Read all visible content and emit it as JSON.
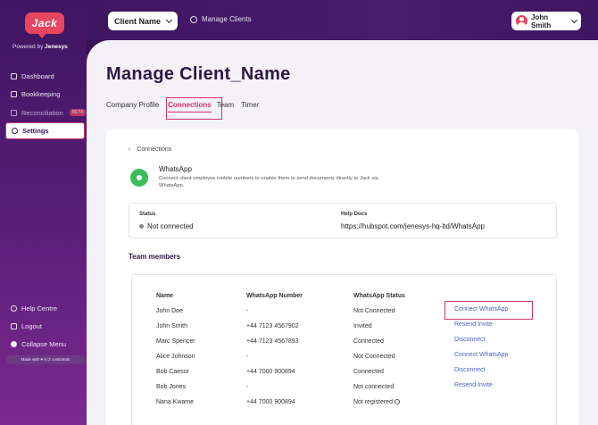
{
  "header": {
    "client_select": "Client Name",
    "manage_clients": "Manage Clients",
    "user_name": "John Smith"
  },
  "brand": {
    "logo_text": "Jack",
    "powered_by": "Powered by",
    "powered_brand": "Jenesys"
  },
  "sidebar": {
    "items": [
      {
        "label": "Dashboard",
        "icon": "grid-icon"
      },
      {
        "label": "Bookkeeping",
        "icon": "book-icon"
      },
      {
        "label": "Reconciliation",
        "icon": "reconcile-icon",
        "badge": "BETA"
      },
      {
        "label": "Settings",
        "icon": "gear-icon"
      }
    ],
    "bottom": [
      {
        "label": "Help Centre",
        "icon": "help-icon"
      },
      {
        "label": "Logout",
        "icon": "logout-icon"
      },
      {
        "label": "Collapse Menu",
        "icon": "collapse-icon"
      }
    ],
    "made_with": "Made with ♥ in 3 continents"
  },
  "page": {
    "title": "Manage Client_Name",
    "tabs": [
      "Company Profile",
      "Connections",
      "Team",
      "Timer"
    ],
    "active_tab": "Connections"
  },
  "connection": {
    "breadcrumb": "Connections",
    "name": "WhatsApp",
    "description": "Connect client employee mobile numbers to enable them to send documents directly to Jack via WhatsApp.",
    "status_label": "Status",
    "status_value": "Not connected",
    "help_label": "Help Docs",
    "help_value": "https://hubspot.com/jenesys-hq-ltd/WhatsApp"
  },
  "team": {
    "title": "Team members",
    "columns": [
      "Name",
      "WhatsApp Number",
      "WhatsApp Status"
    ],
    "rows": [
      {
        "name": "John Doe",
        "number": "-",
        "status": "Not Connected",
        "action": "Connect WhatsApp"
      },
      {
        "name": "John Smith",
        "number": "+44 7123 4567902",
        "status": "Invited",
        "action": "Resend Invite"
      },
      {
        "name": "Marc Spencer",
        "number": "+44 7123 4567893",
        "status": "Connected",
        "action": "Disconnect"
      },
      {
        "name": "Alice Johnson",
        "number": "-",
        "status": "Not Connected",
        "action": "Connect WhatsApp"
      },
      {
        "name": "Bob Caesor",
        "number": "+44 7000 900894",
        "status": "Connected",
        "action": "Disconnect"
      },
      {
        "name": "Bob Jones",
        "number": "-",
        "status": "Not connected",
        "action": "Resend Invite"
      },
      {
        "name": "Nana Kwame",
        "number": "+44 7000 900894",
        "status": "Not registered",
        "action": ""
      }
    ]
  },
  "colors": {
    "brand": "#e8455e",
    "sidebar": "#3e1560",
    "accent": "#d4326b",
    "link": "#4a5fbf"
  }
}
